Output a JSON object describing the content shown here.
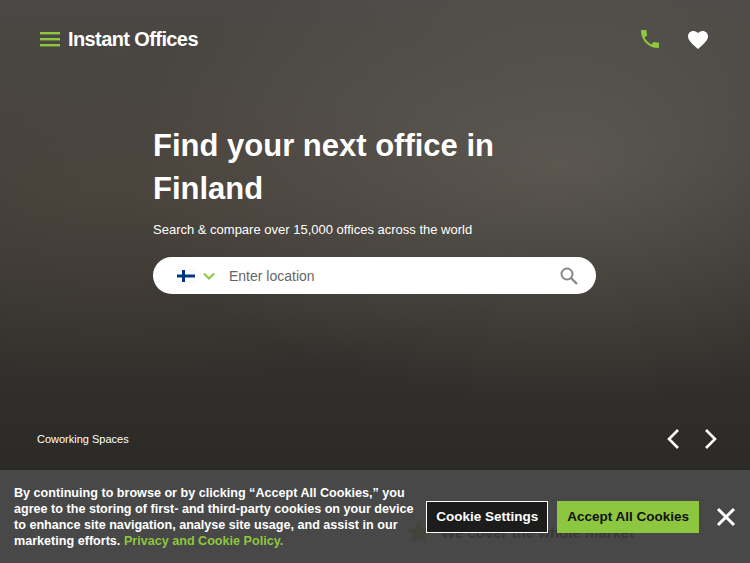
{
  "header": {
    "logo": "Instant Offices"
  },
  "hero": {
    "title": "Find your next office in Finland",
    "subtitle": "Search & compare over 15,000 offices across the world",
    "search": {
      "placeholder": "Enter location"
    },
    "caption": "Coworking Spaces"
  },
  "section": {
    "heading": "We cover the whole market"
  },
  "cookie_banner": {
    "text": "By continuing to browse or by clicking “Accept All Cookies,” you agree to the storing of first- and third-party cookies on your device to enhance site navigation, analyse site usage, and assist in our marketing efforts.",
    "link": "Privacy and Cookie Policy.",
    "buttons": [
      {
        "label": "Cookie Settings",
        "kind": "outline"
      },
      {
        "label": "Accept All Cookies",
        "kind": "primary"
      }
    ]
  }
}
